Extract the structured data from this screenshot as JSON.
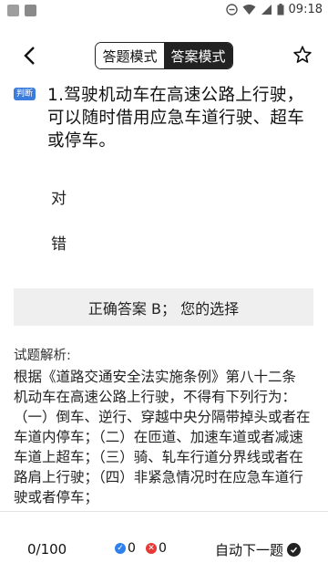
{
  "status_bar": {
    "time": "09:18",
    "colors": {
      "icon": "#9e9e9e"
    }
  },
  "header": {
    "mode_tabs": [
      {
        "label": "答题模式",
        "active": false
      },
      {
        "label": "答案模式",
        "active": true
      }
    ]
  },
  "question": {
    "badge": "判断",
    "text": "1.驾驶机动车在高速公路上行驶，可以随时借用应急车道行驶、超车或停车。",
    "options": [
      "对",
      "错"
    ]
  },
  "answer": {
    "text": "正确答案 B； 您的选择"
  },
  "analysis": {
    "label": "试题解析:",
    "paragraphs": [
      "根据《道路交通安全法实施条例》第八十二条",
      "机动车在高速公路上行驶，不得有下列行为：（一）倒车、逆行、穿越中央分隔带掉头或者在车道内停车；（二）在匝道、加速车道或者减速车道上超车；（三）骑、轧车行道分界线或者在路肩上行驶；（四）非紧急情况时在应急车道行驶或者停车；"
    ]
  },
  "footer": {
    "progress": "0/100",
    "correct_count": "0",
    "wrong_count": "0",
    "auto_next_label": "自动下一题",
    "colors": {
      "correct": "#2f80ed",
      "wrong": "#e53935",
      "badge": "#3b7ddd"
    }
  }
}
